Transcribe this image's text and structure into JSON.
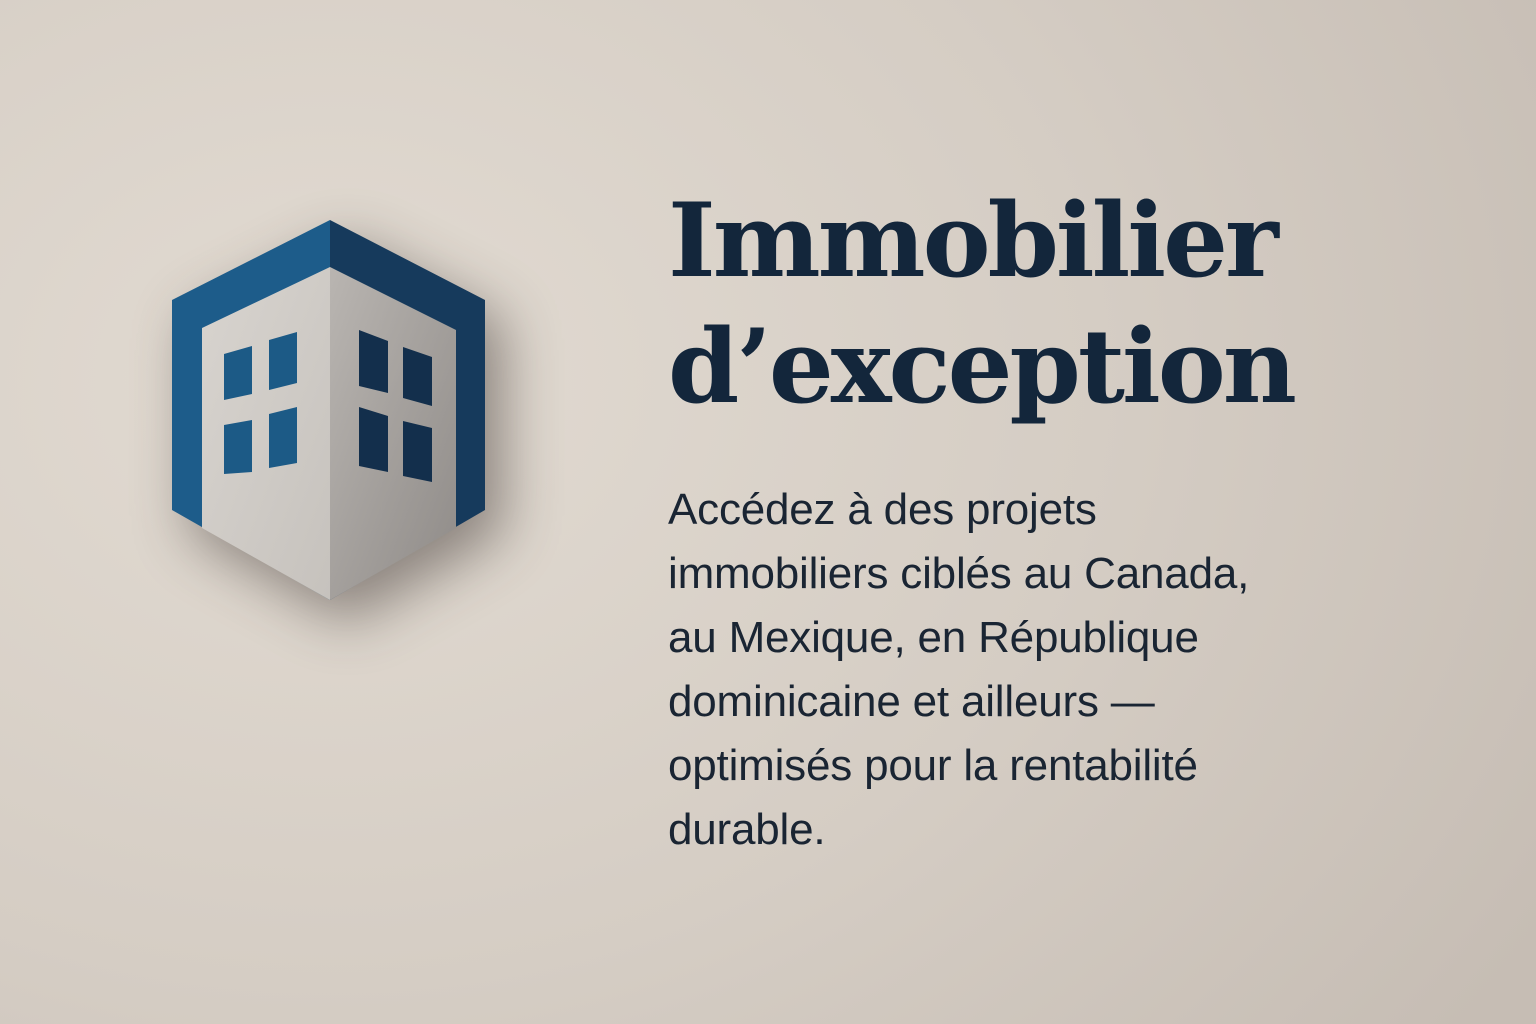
{
  "logo": {
    "icon": "building-hexagon-icon",
    "colors": {
      "frame": "#1d5c8a",
      "frame_dark": "#163a5c",
      "face_light": "#d2cec9",
      "face_shade": "#a9a5a1",
      "window_left": "#1c5a86",
      "window_right": "#132f4c"
    }
  },
  "headline": {
    "line_1": "Immobilier",
    "line_2": "d’exception",
    "color": "#13263b"
  },
  "body": {
    "line_1": "Accédez à des projets",
    "line_2": "immobiliers ciblés au Canada,",
    "line_3": "au Mexique, en République",
    "line_4": "dominicaine et ailleurs —",
    "line_5": "optimisés pour la rentabilité",
    "line_6": "durable.",
    "color": "#1a2533"
  },
  "background": {
    "color": "#d6cec5"
  }
}
